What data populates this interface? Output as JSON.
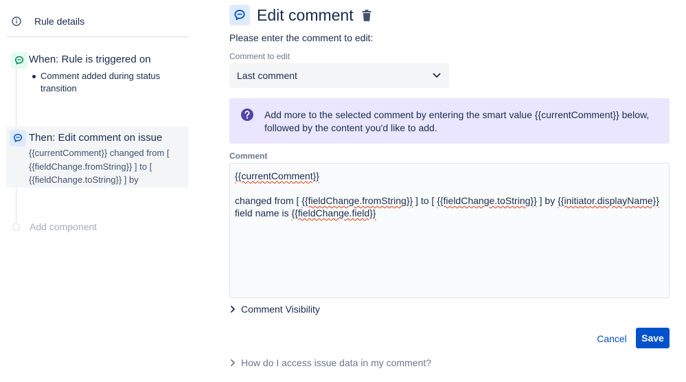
{
  "sidebar": {
    "rule_details_label": "Rule details",
    "trigger": {
      "title": "When: Rule is triggered on",
      "bullets": [
        "Comment added during status transition"
      ]
    },
    "action": {
      "title": "Then: Edit comment on issue",
      "description": "{{currentComment}} changed from [ {{fieldChange.fromString}} ] to [ {{fieldChange.toString}} ] by"
    },
    "add_component_label": "Add component"
  },
  "main": {
    "title": "Edit comment",
    "instruction": "Please enter the comment to edit:",
    "comment_to_edit": {
      "label": "Comment to edit",
      "selected": "Last comment"
    },
    "info_text": "Add more to the selected comment by entering the smart value {{currentComment}} below, followed by the content you'd like to add.",
    "comment": {
      "label": "Comment",
      "line1": {
        "value": "{{currentComment}}"
      },
      "line2": {
        "p1": "changed from [ ",
        "v1": "{{fieldChange.fromString}}",
        "p2": " ] to [ ",
        "v2": "{{fieldChange.toString}}",
        "p3": " ] by ",
        "v3": "{{initiator.displayName}}"
      },
      "line3": {
        "p1": "field name is ",
        "v1": "{{fieldChange.field}}"
      }
    },
    "comment_visibility_label": "Comment Visibility",
    "cancel_label": "Cancel",
    "save_label": "Save",
    "help_label": "How do I access issue data in my comment?"
  },
  "icons": {
    "info": "info-circle-icon",
    "comment": "comment-bubble-icon",
    "trash": "trash-icon",
    "question": "question-circle-icon",
    "chevron_down": "chevron-down-icon",
    "chevron_right": "chevron-right-icon"
  },
  "colors": {
    "primary": "#0052cc",
    "info_panel_bg": "#eae6ff",
    "question_icon": "#5243aa",
    "trigger_icon_bg": "#e3fcef",
    "trigger_icon_fg": "#00875a",
    "action_icon_bg": "#deebff",
    "action_icon_fg": "#0052cc",
    "spellcheck": "#de350b"
  }
}
